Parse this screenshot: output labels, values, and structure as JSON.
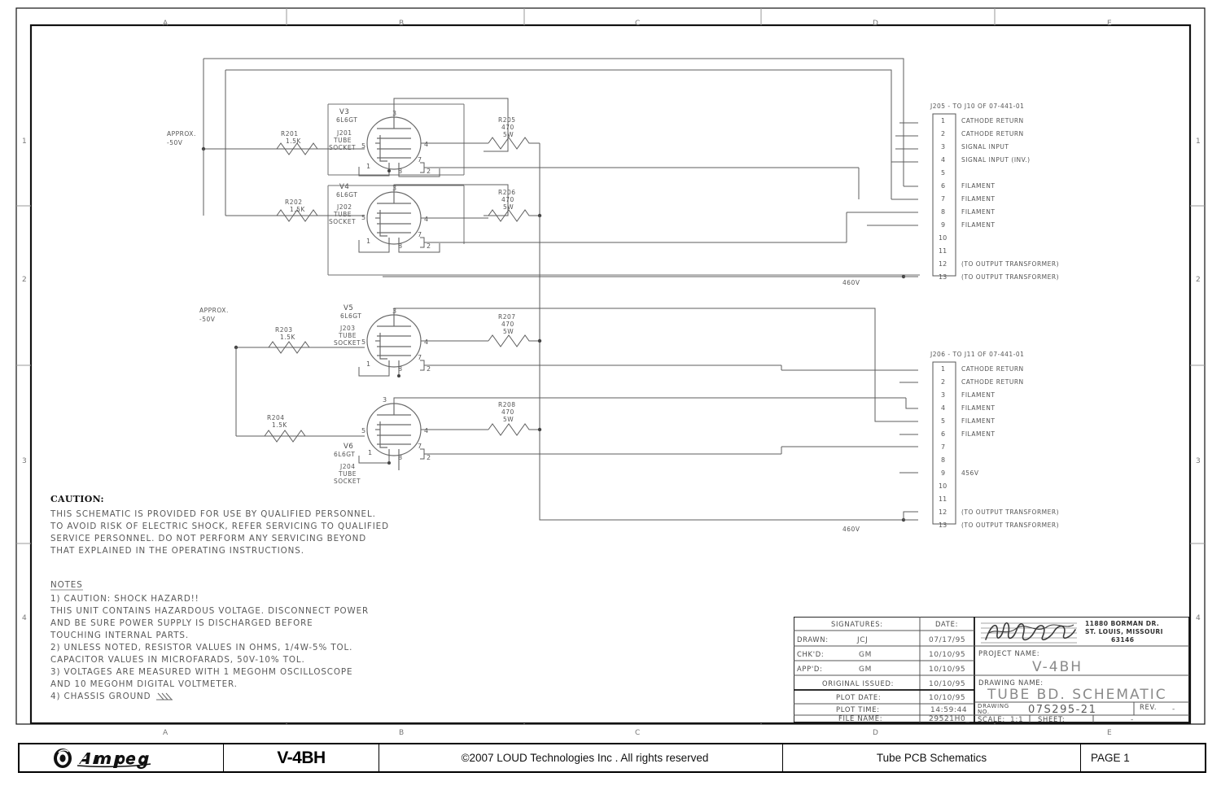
{
  "sheet": {
    "zones_top": [
      "A",
      "B",
      "C",
      "D",
      "E"
    ],
    "zones_bottom": [
      "A",
      "B",
      "C",
      "D",
      "E"
    ],
    "rows_left": [
      "1",
      "2",
      "3",
      "4"
    ],
    "rows_right": [
      "1",
      "2",
      "3",
      "4"
    ]
  },
  "bias_labels": [
    {
      "l1": "APPROX.",
      "l2": "-50V"
    },
    {
      "l1": "APPROX.",
      "l2": "-50V"
    }
  ],
  "tubes": [
    {
      "ref": "V3",
      "type": "6L6GT",
      "socket_ref": "J201",
      "socket_l1": "TUBE",
      "socket_l2": "SOCKET",
      "pins": [
        "3",
        "4",
        "7",
        "2",
        "8",
        "1",
        "5"
      ]
    },
    {
      "ref": "V4",
      "type": "6L6GT",
      "socket_ref": "J202",
      "socket_l1": "TUBE",
      "socket_l2": "SOCKET",
      "pins": [
        "3",
        "4",
        "7",
        "2",
        "8",
        "1",
        "5"
      ]
    },
    {
      "ref": "V5",
      "type": "6L6GT",
      "socket_ref": "J203",
      "socket_l1": "TUBE",
      "socket_l2": "SOCKET",
      "pins": [
        "3",
        "4",
        "7",
        "2",
        "8",
        "1",
        "5"
      ]
    },
    {
      "ref": "V6",
      "type": "6L6GT",
      "socket_ref": "J204",
      "socket_l1": "TUBE",
      "socket_l2": "SOCKET",
      "pins": [
        "3",
        "4",
        "7",
        "2",
        "8",
        "1",
        "5"
      ]
    }
  ],
  "resistors": [
    {
      "ref": "R201",
      "value": "1.5K",
      "power": ""
    },
    {
      "ref": "R202",
      "value": "1.5K",
      "power": ""
    },
    {
      "ref": "R203",
      "value": "1.5K",
      "power": ""
    },
    {
      "ref": "R204",
      "value": "1.5K",
      "power": ""
    },
    {
      "ref": "R205",
      "value": "470",
      "power": "5W"
    },
    {
      "ref": "R206",
      "value": "470",
      "power": "5W"
    },
    {
      "ref": "R207",
      "value": "470",
      "power": "5W"
    },
    {
      "ref": "R208",
      "value": "470",
      "power": "5W"
    }
  ],
  "net_labels": [
    {
      "text": "460V"
    },
    {
      "text": "460V"
    }
  ],
  "connectors": [
    {
      "title": "J205 - TO J10 OF 07-441-01",
      "pins": [
        {
          "num": "1",
          "label": "CATHODE RETURN"
        },
        {
          "num": "2",
          "label": "CATHODE RETURN"
        },
        {
          "num": "3",
          "label": "SIGNAL INPUT"
        },
        {
          "num": "4",
          "label": "SIGNAL INPUT (INV.)"
        },
        {
          "num": "5",
          "label": ""
        },
        {
          "num": "6",
          "label": "FILAMENT"
        },
        {
          "num": "7",
          "label": "FILAMENT"
        },
        {
          "num": "8",
          "label": "FILAMENT"
        },
        {
          "num": "9",
          "label": "FILAMENT"
        },
        {
          "num": "10",
          "label": ""
        },
        {
          "num": "11",
          "label": ""
        },
        {
          "num": "12",
          "label": "(TO OUTPUT TRANSFORMER)"
        },
        {
          "num": "13",
          "label": "(TO OUTPUT TRANSFORMER)"
        }
      ]
    },
    {
      "title": "J206 - TO J11 OF 07-441-01",
      "pins": [
        {
          "num": "1",
          "label": "CATHODE RETURN"
        },
        {
          "num": "2",
          "label": "CATHODE RETURN"
        },
        {
          "num": "3",
          "label": "FILAMENT"
        },
        {
          "num": "4",
          "label": "FILAMENT"
        },
        {
          "num": "5",
          "label": "FILAMENT"
        },
        {
          "num": "6",
          "label": "FILAMENT"
        },
        {
          "num": "7",
          "label": ""
        },
        {
          "num": "8",
          "label": ""
        },
        {
          "num": "9",
          "label": "456V"
        },
        {
          "num": "10",
          "label": ""
        },
        {
          "num": "11",
          "label": ""
        },
        {
          "num": "12",
          "label": "(TO OUTPUT TRANSFORMER)"
        },
        {
          "num": "13",
          "label": "(TO OUTPUT TRANSFORMER)"
        }
      ]
    }
  ],
  "caution": {
    "heading": "CAUTION:",
    "lines": [
      "THIS SCHEMATIC IS PROVIDED FOR USE BY QUALIFIED PERSONNEL.",
      "TO AVOID RISK OF ELECTRIC SHOCK, REFER SERVICING TO QUALIFIED",
      "SERVICE PERSONNEL.   DO NOT PERFORM ANY SERVICING BEYOND",
      "THAT EXPLAINED IN THE OPERATING INSTRUCTIONS."
    ]
  },
  "notes": {
    "heading": "NOTES",
    "lines": [
      "1) CAUTION:   SHOCK HAZARD!!",
      "     THIS UNIT CONTAINS HAZARDOUS VOLTAGE.   DISCONNECT POWER",
      "   AND BE SURE POWER SUPPLY IS DISCHARGED BEFORE",
      "   TOUCHING INTERNAL PARTS.",
      "2) UNLESS NOTED, RESISTOR VALUES IN OHMS, 1/4W-5% TOL.",
      "   CAPACITOR VALUES IN MICROFARADS, 50V-10% TOL.",
      "3) VOLTAGES ARE MEASURED WITH 1 MEGOHM OSCILLOSCOPE",
      "   AND 10 MEGOHM DIGITAL VOLTMETER.",
      "4) CHASSIS GROUND"
    ]
  },
  "title_block": {
    "signatures_header": "SIGNATURES:",
    "date_header": "DATE:",
    "rows": [
      {
        "label": "DRAWN:",
        "value": "JCJ",
        "date": "07/17/95"
      },
      {
        "label": "CHK'D:",
        "value": "GM",
        "date": "10/10/95"
      },
      {
        "label": "APP'D:",
        "value": "GM",
        "date": "10/10/95"
      }
    ],
    "original_issued_label": "ORIGINAL ISSUED:",
    "original_issued_date": "10/10/95",
    "plot_date_label": "PLOT DATE:",
    "plot_date_value": "10/10/95",
    "plot_time_label": "PLOT TIME:",
    "plot_time_value": "14:59:44",
    "file_name_label": "FILE NAME:",
    "file_name_value": "29521H0_",
    "company_address": [
      "11880 BORMAN DR.",
      "ST. LOUIS, MISSOURI",
      "63146"
    ],
    "project_name_label": "PROJECT NAME:",
    "project_name_value": "V-4BH",
    "drawing_name_label": "DRAWING NAME:",
    "drawing_name_value": "TUBE BD. SCHEMATIC",
    "drawing_no_label1": "DRAWING",
    "drawing_no_label2": "NO.",
    "drawing_no_value": "07S295-21",
    "rev_label": "REV.",
    "rev_value": "-",
    "scale_label": "SCALE:",
    "scale_value": "1:1",
    "sheet_label": "SHEET:",
    "sheet_value": "-"
  },
  "footer": {
    "brand": "Ampeg",
    "model": "V-4BH",
    "copyright": "©2007 LOUD Technologies Inc . All rights reserved",
    "doc_title": "Tube PCB Schematics",
    "page": "PAGE 1"
  }
}
